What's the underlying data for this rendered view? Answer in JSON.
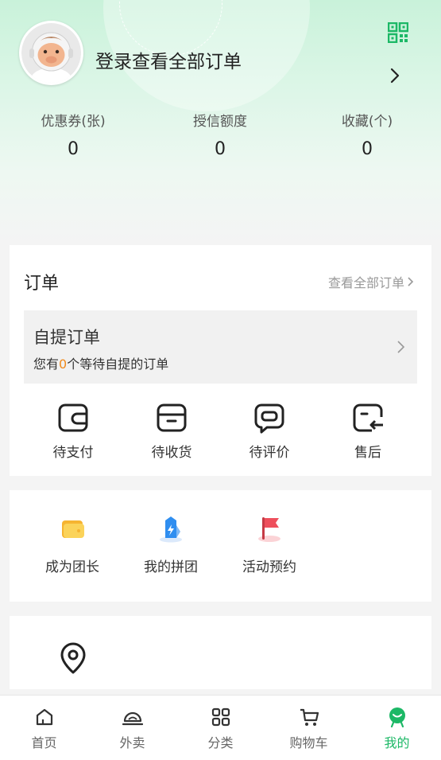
{
  "header": {
    "login_text": "登录查看全部订单"
  },
  "stats": [
    {
      "label": "优惠券(张)",
      "value": "0"
    },
    {
      "label": "授信额度",
      "value": "0"
    },
    {
      "label": "收藏(个)",
      "value": "0"
    }
  ],
  "orders": {
    "title": "订单",
    "view_all": "查看全部订单",
    "pickup": {
      "title": "自提订单",
      "sub_prefix": "您有",
      "count": "0",
      "sub_suffix": "个等待自提的订单"
    },
    "items": [
      {
        "label": "待支付",
        "icon": "wallet-icon"
      },
      {
        "label": "待收货",
        "icon": "box-icon"
      },
      {
        "label": "待评价",
        "icon": "comment-icon"
      },
      {
        "label": "售后",
        "icon": "return-icon"
      }
    ]
  },
  "tools": [
    {
      "label": "成为团长",
      "icon": "yellow-wallet-icon"
    },
    {
      "label": "我的拼团",
      "icon": "blue-tag-icon"
    },
    {
      "label": "活动预约",
      "icon": "red-flag-icon"
    }
  ],
  "tabbar": [
    {
      "label": "首页",
      "icon": "home-icon",
      "active": false
    },
    {
      "label": "外卖",
      "icon": "takeout-icon",
      "active": false
    },
    {
      "label": "分类",
      "icon": "grid-icon",
      "active": false
    },
    {
      "label": "购物车",
      "icon": "cart-icon",
      "active": false
    },
    {
      "label": "我的",
      "icon": "profile-icon",
      "active": true
    }
  ],
  "colors": {
    "accent": "#1cb866",
    "count_highlight": "#f08a1c"
  }
}
